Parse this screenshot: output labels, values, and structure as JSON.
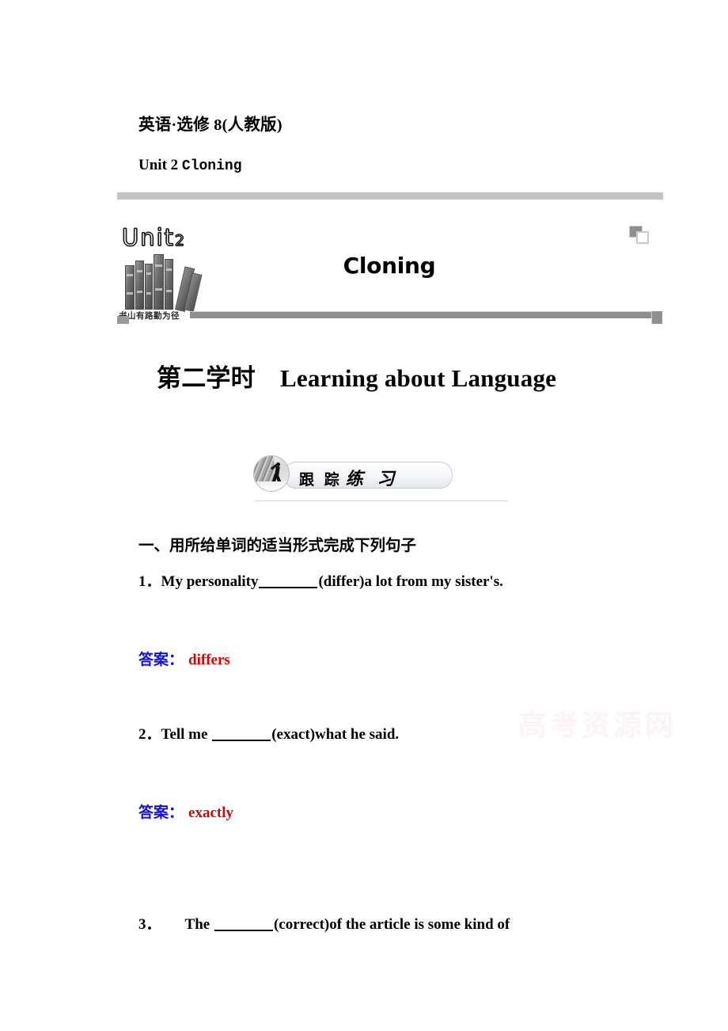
{
  "header": {
    "book_line": "英语·选修 8(人教版)",
    "unit_label": "Unit 2",
    "unit_name": "Cloning"
  },
  "banner": {
    "unit_word": "Unit",
    "unit_number": "2",
    "books_caption": "书山有路勤为径",
    "title": "Cloning",
    "corner_icon": "overlapping-squares-icon"
  },
  "period": {
    "title": "第二学时　Learning about Language"
  },
  "badge": {
    "label_front": "跟 踪",
    "label_brush": "练 习",
    "photo_icon": "climber-photo-icon"
  },
  "exercises": {
    "section_heading": "一、用所给单词的适当形式完成下列句子",
    "items": [
      {
        "number": "1．",
        "text_before": "My personality",
        "text_after": "(differ)a lot from my sister's.",
        "answer_label": "答案：",
        "answer_value": "differs"
      },
      {
        "number": "2．",
        "text_before": "Tell me ",
        "text_after": "(exact)what he said.",
        "answer_label": "答案：",
        "answer_value": "exactly"
      },
      {
        "number": "3．",
        "text_before": "The ",
        "text_after": "(correct)of the article is some kind of"
      }
    ]
  },
  "watermark": {
    "text": "高考资源网"
  },
  "colors": {
    "answer_label": "#1111dd",
    "answer_value": "#e00000",
    "banner_bar": "#c3c3c3",
    "banner_bar_dark": "#8f8f8f",
    "watermark": "#fdf3f4"
  }
}
